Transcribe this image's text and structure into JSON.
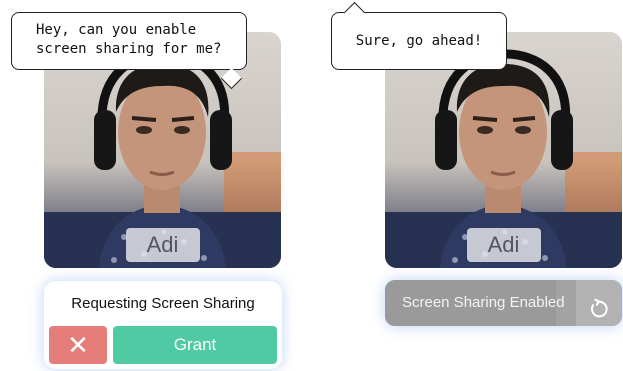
{
  "left_panel": {
    "speech_bubble": {
      "line1": "Hey, can you enable",
      "line2": "screen sharing for me?"
    },
    "participant": {
      "name": "Adi"
    },
    "request_card": {
      "title": "Requesting Screen Sharing",
      "deny_symbol": "✕",
      "grant_label": "Grant"
    }
  },
  "right_panel": {
    "speech_bubble": {
      "text": "Sure, go ahead!"
    },
    "participant": {
      "name": "Adi"
    },
    "status_bar": {
      "label": "Screen Sharing Enabled",
      "progress_fraction": 0.72,
      "reset_icon": "reset-icon"
    }
  },
  "colors": {
    "deny": "#e57d7b",
    "grant": "#4fcaa3",
    "status_bar": "#a3a3a3",
    "card_glow": "#6ea0f0"
  }
}
